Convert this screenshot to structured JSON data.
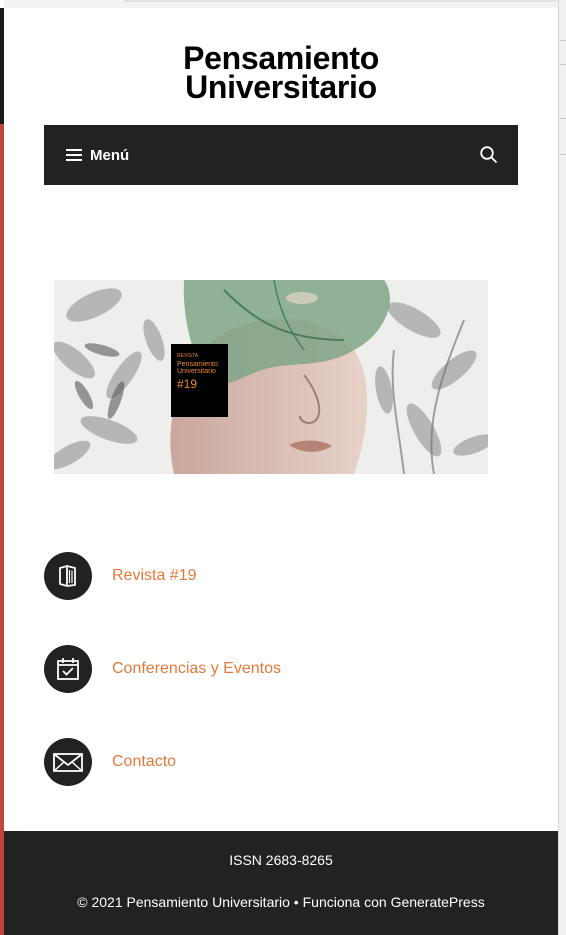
{
  "site": {
    "logo_line1": "Pensamiento",
    "logo_line2": "Universitario"
  },
  "nav": {
    "menu_label": "Menú",
    "menu_icon": "hamburger-icon",
    "search_icon": "search-icon"
  },
  "hero": {
    "badge_kicker": "REVISTA",
    "badge_title_1": "Pensamiento",
    "badge_title_2": "Universitario",
    "badge_issue": "#19"
  },
  "links": [
    {
      "label": "Revista #19",
      "icon": "book-icon"
    },
    {
      "label": "Conferencias y Eventos",
      "icon": "calendar-icon"
    },
    {
      "label": "Contacto",
      "icon": "envelope-icon"
    }
  ],
  "footer": {
    "issn": "ISSN 2683-8265",
    "copyright": "© 2021 Pensamiento Universitario",
    "separator": " • ",
    "powered_prefix": "Funciona con ",
    "powered_link": "GeneratePress"
  },
  "colors": {
    "link": "#e07a3a",
    "bar": "#222222",
    "badge_text": "#f08a2a"
  }
}
